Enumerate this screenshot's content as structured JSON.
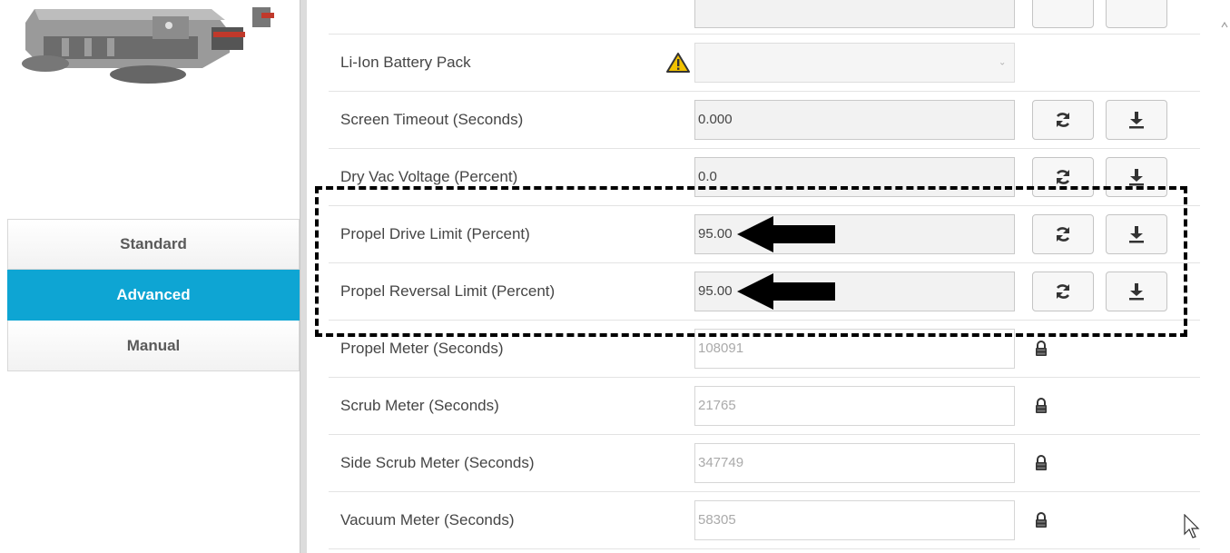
{
  "sidebar": {
    "machine_image_icon": "floor-scrubber-machine",
    "tabs": [
      {
        "label": "Standard",
        "active": false
      },
      {
        "label": "Advanced",
        "active": true
      },
      {
        "label": "Manual",
        "active": false
      }
    ]
  },
  "settings": {
    "top_row": {
      "label": "",
      "value": ""
    },
    "battery": {
      "label": "Li-Ion Battery Pack",
      "value": "",
      "warning_icon": "warning-triangle-icon"
    },
    "rows": [
      {
        "label": "Screen Timeout (Seconds)",
        "value": "0.000"
      },
      {
        "label": "Dry Vac Voltage (Percent)",
        "value": "0.0"
      },
      {
        "label": "Propel Drive Limit (Percent)",
        "value": "95.00"
      },
      {
        "label": "Propel Reversal Limit (Percent)",
        "value": "95.00"
      }
    ],
    "locked_rows": [
      {
        "label": "Propel Meter (Seconds)",
        "value": "108091"
      },
      {
        "label": "Scrub Meter (Seconds)",
        "value": "21765"
      },
      {
        "label": "Side Scrub Meter (Seconds)",
        "value": "347749"
      },
      {
        "label": "Vacuum Meter (Seconds)",
        "value": "58305"
      }
    ]
  },
  "colors": {
    "accent": "#0ea5d3",
    "annotation": "#000000",
    "warning": "#f2c200"
  }
}
